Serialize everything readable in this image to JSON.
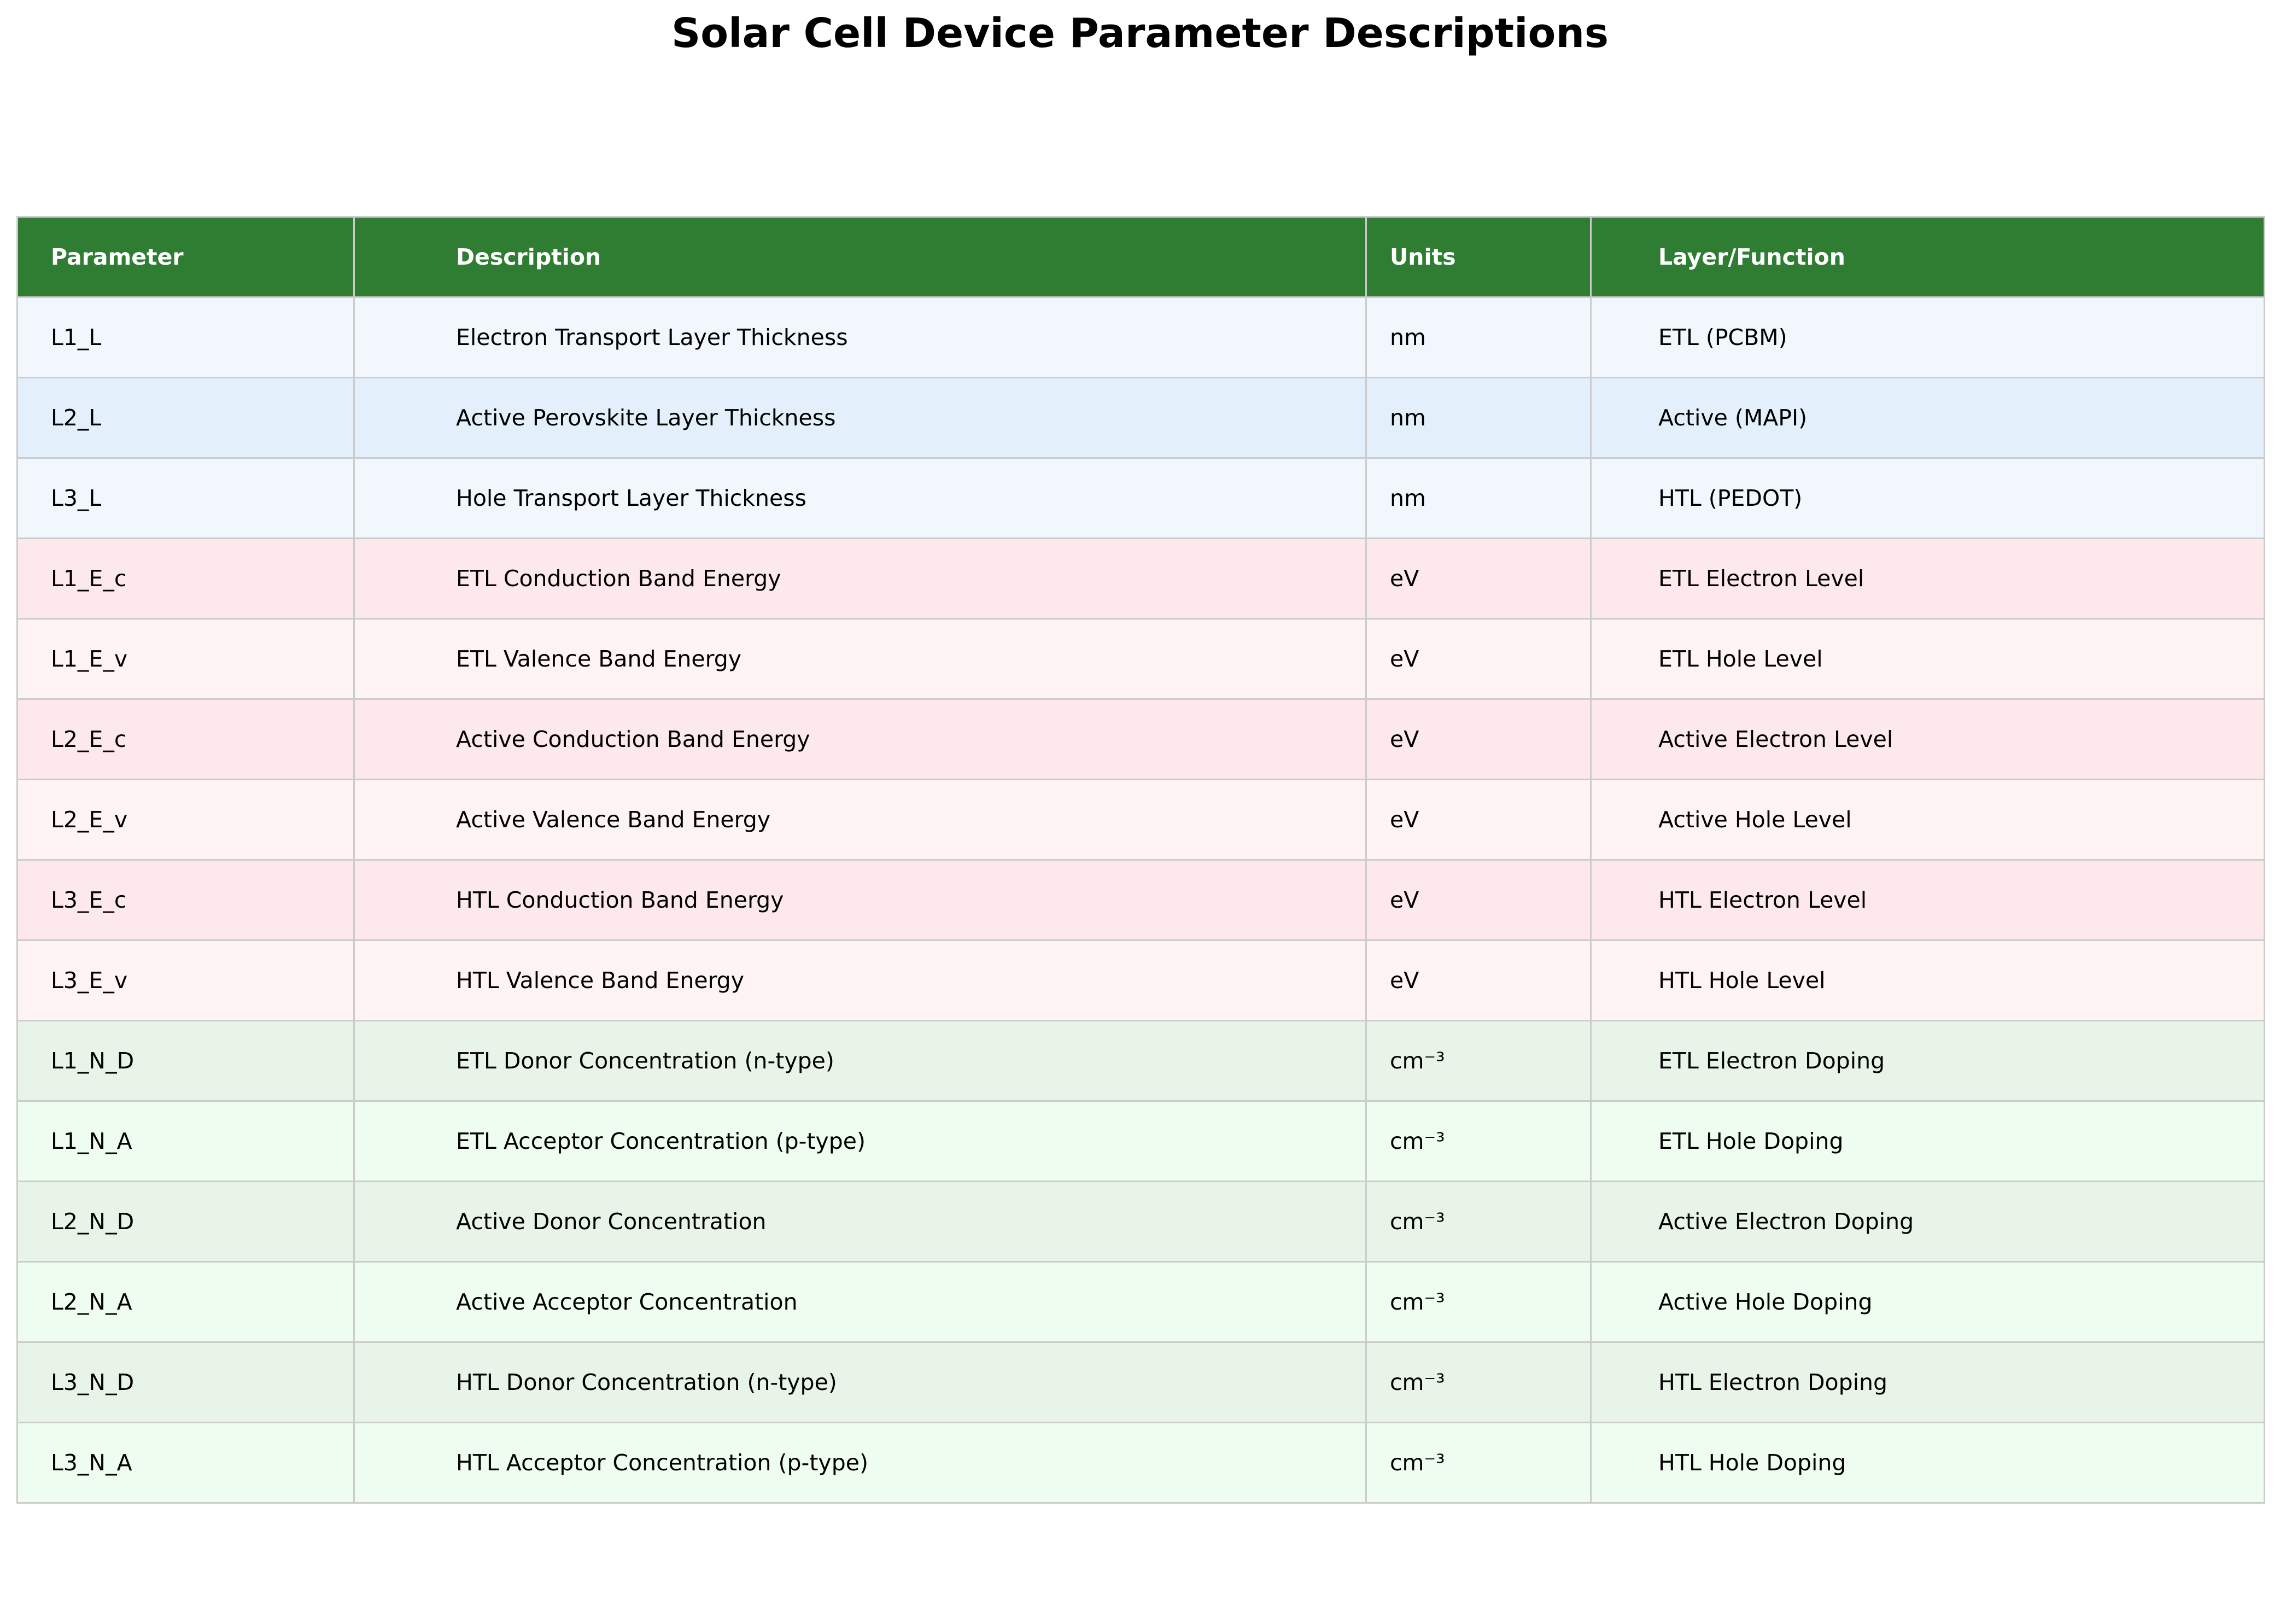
{
  "chart_data": {
    "type": "table",
    "title": "Solar Cell Device Parameter Descriptions",
    "columns": [
      "Parameter",
      "Description",
      "Units",
      "Layer/Function"
    ],
    "rows": [
      {
        "cells": [
          "L1_L",
          "Electron Transport Layer Thickness",
          "nm",
          "ETL (PCBM)"
        ],
        "bg": "#f1f7fd"
      },
      {
        "cells": [
          "L2_L",
          "Active Perovskite Layer Thickness",
          "nm",
          "Active (MAPI)"
        ],
        "bg": "#e3f0fb"
      },
      {
        "cells": [
          "L3_L",
          "Hole Transport Layer Thickness",
          "nm",
          "HTL (PEDOT)"
        ],
        "bg": "#f1f7fd"
      },
      {
        "cells": [
          "L1_E_c",
          "ETL Conduction Band Energy",
          "eV",
          "ETL Electron Level"
        ],
        "bg": "#fde9ec"
      },
      {
        "cells": [
          "L1_E_v",
          "ETL Valence Band Energy",
          "eV",
          "ETL Hole Level"
        ],
        "bg": "#fff4f4"
      },
      {
        "cells": [
          "L2_E_c",
          "Active Conduction Band Energy",
          "eV",
          "Active Electron Level"
        ],
        "bg": "#fde9ec"
      },
      {
        "cells": [
          "L2_E_v",
          "Active Valence Band Energy",
          "eV",
          "Active Hole Level"
        ],
        "bg": "#fff4f4"
      },
      {
        "cells": [
          "L3_E_c",
          "HTL Conduction Band Energy",
          "eV",
          "HTL Electron Level"
        ],
        "bg": "#fde9ec"
      },
      {
        "cells": [
          "L3_E_v",
          "HTL Valence Band Energy",
          "eV",
          "HTL Hole Level"
        ],
        "bg": "#fff4f4"
      },
      {
        "cells": [
          "L1_N_D",
          "ETL Donor Concentration (n-type)",
          "cm⁻³",
          "ETL Electron Doping"
        ],
        "bg": "#e8f4e8"
      },
      {
        "cells": [
          "L1_N_A",
          "ETL Acceptor Concentration (p-type)",
          "cm⁻³",
          "ETL Hole Doping"
        ],
        "bg": "#effdf0"
      },
      {
        "cells": [
          "L2_N_D",
          "Active Donor Concentration",
          "cm⁻³",
          "Active Electron Doping"
        ],
        "bg": "#e8f4e8"
      },
      {
        "cells": [
          "L2_N_A",
          "Active Acceptor Concentration",
          "cm⁻³",
          "Active Hole Doping"
        ],
        "bg": "#effdf0"
      },
      {
        "cells": [
          "L3_N_D",
          "HTL Donor Concentration (n-type)",
          "cm⁻³",
          "HTL Electron Doping"
        ],
        "bg": "#e8f4e8"
      },
      {
        "cells": [
          "L3_N_A",
          "HTL Acceptor Concentration (p-type)",
          "cm⁻³",
          "HTL Hole Doping"
        ],
        "bg": "#effdf0"
      }
    ],
    "colors": {
      "header_bg": "#2e7d32",
      "header_text": "#ffffff",
      "border": "#cccccc"
    }
  }
}
